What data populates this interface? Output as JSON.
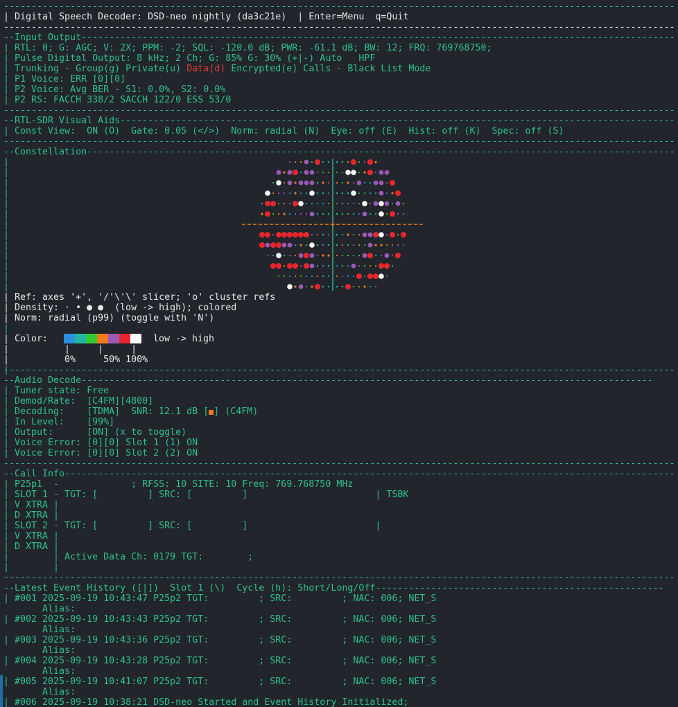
{
  "header": {
    "title": "| Digital Speech Decoder: DSD-neo nightly (da3c21e)  | Enter=Menu  q=Quit"
  },
  "input_output": {
    "title": "--Input Output",
    "lines": [
      "| RTL: 0; G: AGC; V: 2X; PPM: -2; SQL: -120.0 dB; PWR: -61.1 dB; BW: 12; FRQ: 769768750;",
      "| Pulse Digital Output: 8 kHz; 2 Ch; G: 85% G: 30% (+|-) Auto   HPF"
    ],
    "trunking_prefix": "| Trunking - Group(g) Private(u) ",
    "trunking_data": "Data(d)",
    "trunking_suffix": " Encrypted(e) Calls - Black List Mode",
    "p1_voice": "| P1 Voice: ERR [0][0]",
    "p2_voice": "| P2 Voice: Avg BER - S1: 0.0%, S2: 0.0%",
    "p2_rs": "| P2 RS: FACCH 338/2 SACCH 122/0 ESS 53/0"
  },
  "visual_aids": {
    "title": "--RTL-SDR Visual Aids",
    "line": "| Const View:  ON (O)  Gate: 0.05 (</>)  Norm: radial (N)  Eye: off (E)  Hist: off (K)  Spec: off (S)"
  },
  "constellation": {
    "title": "--Constellation",
    "ref_line": "| Ref: axes '+', '/'\\'\\' slicer; 'o' cluster refs",
    "density_line": "| Density: · • ● ●  (low -> high); colored",
    "norm_line": "| Norm: radial (p99) (toggle with 'N')",
    "color_label": "| Color:",
    "color_range": "low -> high",
    "scale_ticks": "|          |     |     |",
    "scale_labels": "|          0%     50% 100%",
    "palette": [
      "#2d8fe0",
      "#22b8a0",
      "#35c935",
      "#f07c1c",
      "#9b59b6",
      "#e8262e",
      "#ffffff"
    ],
    "axis_color": "#f07c1c"
  },
  "audio_decode": {
    "title": "--Audio Decode",
    "tuner_state": "| Tuner state: Free",
    "demod_rate": "| Demod/Rate:  [C4FM][4800]",
    "decoding_prefix": "| Decoding:    [TDMA]  SNR: 12.1 dB [",
    "decoding_suffix": "] (C4FM)",
    "in_level": "| In Level:    [99%]",
    "output": "| Output:      [ON] (x to toggle)",
    "voice_error_1": "| Voice Error: [0][0] Slot 1 (1) ON",
    "voice_error_2": "| Voice Error: [0][0] Slot 2 (2) ON"
  },
  "call_info": {
    "title": "--Call Info",
    "lines": [
      "| P25p1  -             ; RFSS: 10 SITE: 10 Freq: 769.768750 MHz",
      "| SLOT 1 - TGT: [         ] SRC: [         ]                       | TSBK",
      "| V XTRA |",
      "| D XTRA |",
      "| SLOT 2 - TGT: [         ] SRC: [         ]                       |",
      "| V XTRA |",
      "| D XTRA |",
      "|        | Active Data Ch: 0179 TGT:        ;",
      "|        |"
    ]
  },
  "event_history": {
    "title": "--Latest Event History ([|])  Slot 1 (\\)  Cycle (h): Short/Long/Off",
    "events": [
      {
        "line": "| #001 2025-09-19 10:43:47 P25p2 TGT:         ; SRC:         ; NAC: 006; NET_S",
        "alias": "       Alias:"
      },
      {
        "line": "| #002 2025-09-19 10:43:43 P25p2 TGT:         ; SRC:         ; NAC: 006; NET_S",
        "alias": "       Alias:"
      },
      {
        "line": "| #003 2025-09-19 10:43:36 P25p2 TGT:         ; SRC:         ; NAC: 006; NET_S",
        "alias": "       Alias:"
      },
      {
        "line": "| #004 2025-09-19 10:43:28 P25p2 TGT:         ; SRC:         ; NAC: 006; NET_S",
        "alias": "       Alias:"
      },
      {
        "line": "| #005 2025-09-19 10:41:07 P25p2 TGT:         ; SRC:         ; NAC: 006; NET_S",
        "alias": "       Alias:"
      },
      {
        "line": "| #006 2025-09-19 10:38:21 DSD-neo Started and Event History Initialized;",
        "alias": ""
      }
    ]
  }
}
